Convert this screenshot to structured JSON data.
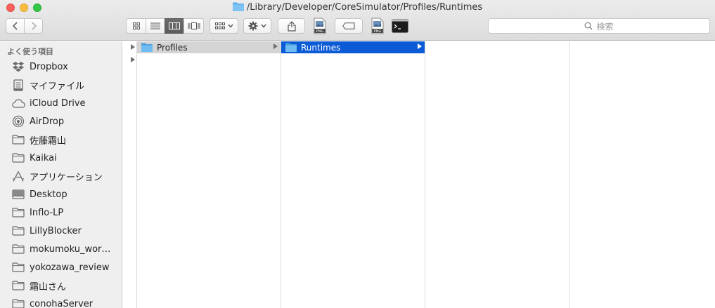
{
  "window": {
    "title": "/Library/Developer/CoreSimulator/Profiles/Runtimes"
  },
  "toolbar": {
    "search_placeholder": "検索",
    "view_modes": [
      "icon-view",
      "list-view",
      "column-view",
      "cover-flow-view"
    ],
    "active_view": "column-view",
    "buttons": [
      "arrange",
      "action",
      "share",
      "png-export",
      "tag",
      "png-export-2",
      "terminal"
    ]
  },
  "sidebar": {
    "header": "よく使う項目",
    "items": [
      {
        "label": "Dropbox",
        "icon": "dropbox-icon"
      },
      {
        "label": "マイファイル",
        "icon": "all-my-files-icon"
      },
      {
        "label": "iCloud Drive",
        "icon": "cloud-icon"
      },
      {
        "label": "AirDrop",
        "icon": "airdrop-icon"
      },
      {
        "label": "佐藤霜山",
        "icon": "folder-icon"
      },
      {
        "label": "Kaikai",
        "icon": "folder-icon"
      },
      {
        "label": "アプリケーション",
        "icon": "applications-icon"
      },
      {
        "label": "Desktop",
        "icon": "desktop-icon"
      },
      {
        "label": "Inflo-LP",
        "icon": "folder-icon"
      },
      {
        "label": "LillyBlocker",
        "icon": "folder-icon"
      },
      {
        "label": "mokumoku_work…",
        "icon": "folder-icon"
      },
      {
        "label": "yokozawa_review",
        "icon": "folder-icon"
      },
      {
        "label": "霜山さん",
        "icon": "folder-icon"
      },
      {
        "label": "conohaServer",
        "icon": "folder-icon"
      }
    ]
  },
  "columns": {
    "col1": [
      {
        "label": "Profiles",
        "state": "parent-selected"
      }
    ],
    "col2": [
      {
        "label": "Runtimes",
        "state": "selected"
      }
    ]
  },
  "colors": {
    "selection_blue": "#0b5bd6",
    "parent_selection_gray": "#d4d4d4",
    "folder_blue": "#5fb0ee"
  }
}
